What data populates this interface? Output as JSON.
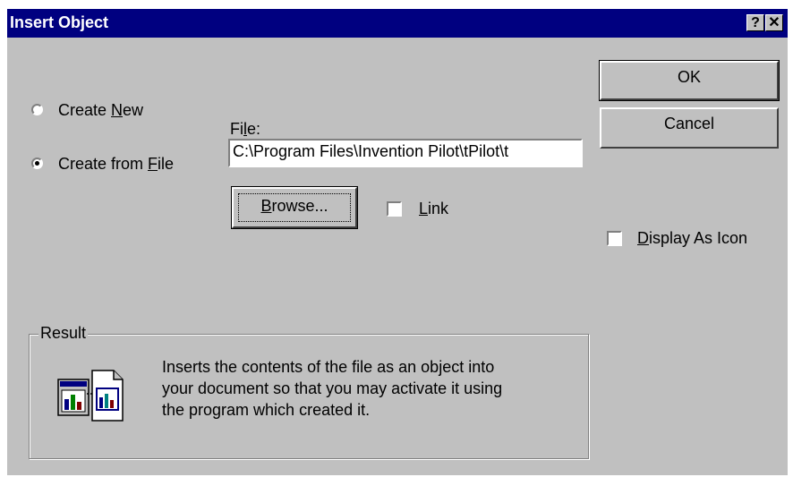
{
  "window": {
    "title": "Insert Object",
    "help_button": "?",
    "close_button": "✕"
  },
  "options": {
    "create_new": {
      "label_pre": "Create ",
      "label_accel": "N",
      "label_post": "ew"
    },
    "create_from_file": {
      "label_pre": "Create from ",
      "label_accel": "F",
      "label_post": "ile"
    }
  },
  "file": {
    "label_pre": "Fi",
    "label_accel": "l",
    "label_post": "e:",
    "value": "C:\\Program Files\\Invention Pilot\\tPilot\\t"
  },
  "browse": {
    "label_accel": "B",
    "label_post": "rowse..."
  },
  "link": {
    "label_accel": "L",
    "label_post": "ink"
  },
  "buttons": {
    "ok": "OK",
    "cancel": "Cancel"
  },
  "display_as_icon": {
    "label_accel": "D",
    "label_post": "isplay As Icon"
  },
  "result": {
    "legend": "Result",
    "line1": "Inserts the contents of the file as an object into",
    "line2": "your document so that you may activate it using",
    "line3": "the program which created it."
  }
}
